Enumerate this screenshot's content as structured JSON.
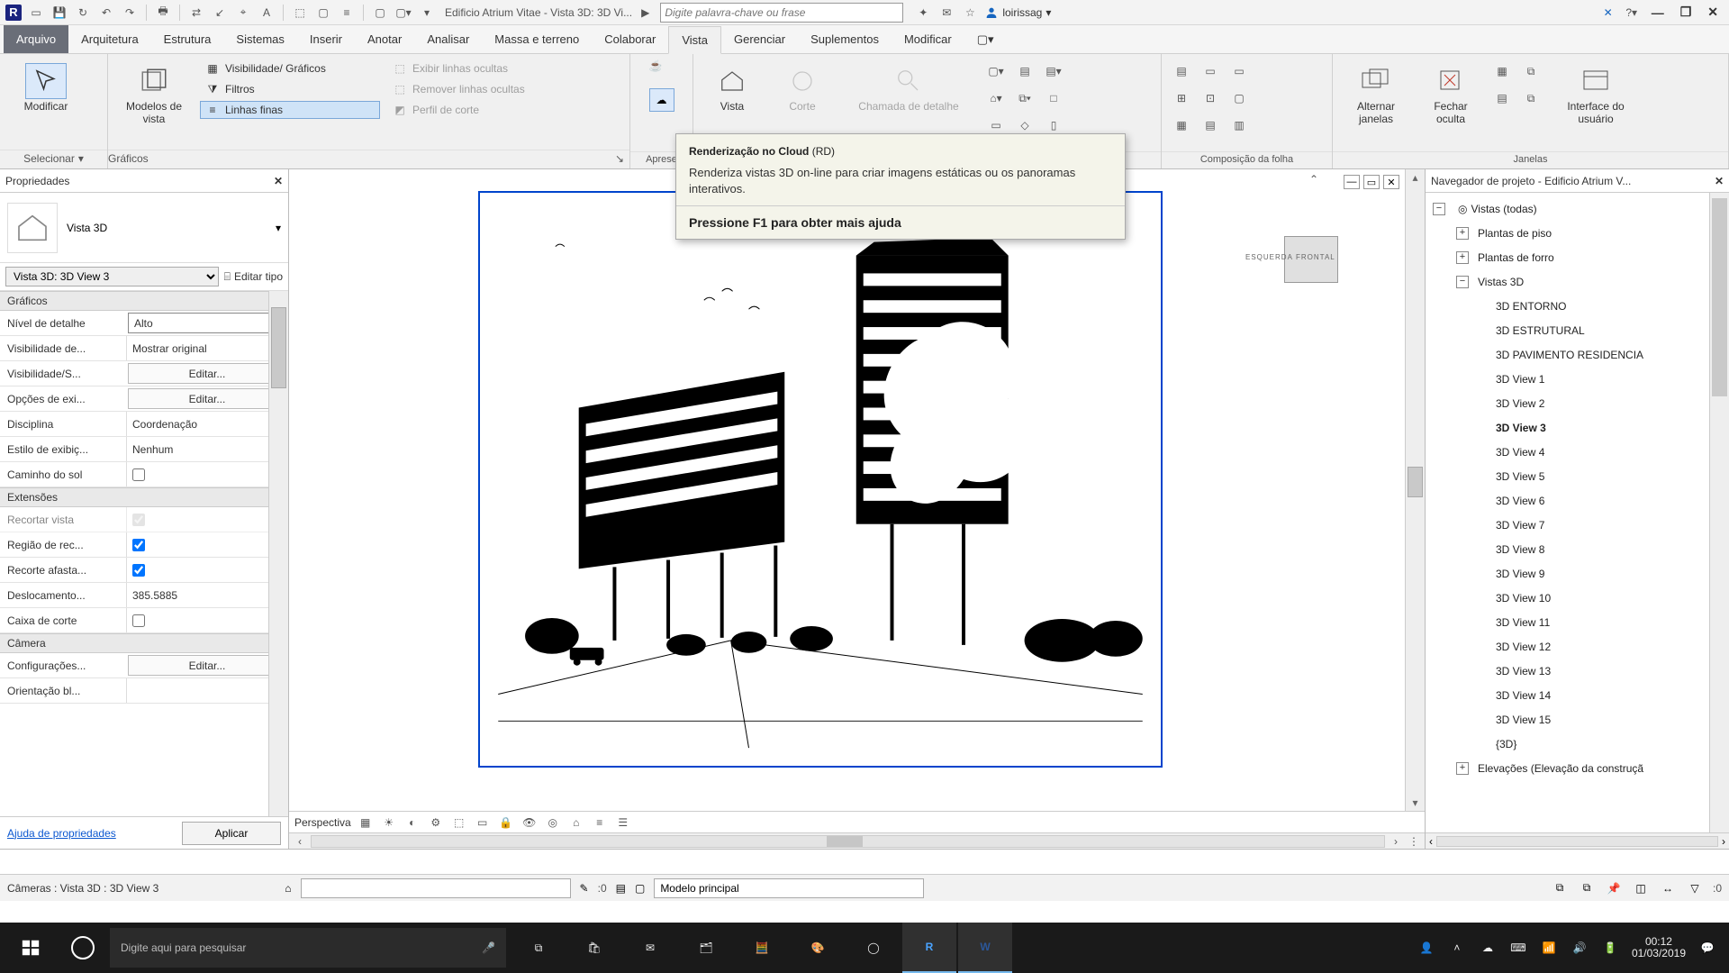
{
  "qat": {
    "title": "Edificio Atrium Vitae - Vista 3D: 3D Vi...",
    "search_placeholder": "Digite palavra-chave ou frase",
    "user": "loirissag"
  },
  "tabs": {
    "file": "Arquivo",
    "items": [
      "Arquitetura",
      "Estrutura",
      "Sistemas",
      "Inserir",
      "Anotar",
      "Analisar",
      "Massa e terreno",
      "Colaborar",
      "Vista",
      "Gerenciar",
      "Suplementos",
      "Modificar"
    ],
    "active": "Vista"
  },
  "ribbon": {
    "selecionar": {
      "btn": "Modificar",
      "panel": "Selecionar"
    },
    "graficos": {
      "modelos": "Modelos de\nvista",
      "vg": "Visibilidade/  Gráficos",
      "filtros": "Filtros",
      "linhas": "Linhas  finas",
      "exibir": "Exibir  linhas ocultas",
      "remover": "Remover  linhas ocultas",
      "perfil": "Perfil  de corte",
      "panel": "Gráficos"
    },
    "apresentacao": {
      "panel": "Aprese"
    },
    "criar": {
      "vista": "Vista",
      "corte": "Corte",
      "chamada": "Chamada de detalhe"
    },
    "composicao": {
      "panel": "Composição da folha"
    },
    "janelas": {
      "alternar": "Alternar\njanelas",
      "fechar": "Fechar\noculta",
      "ui": "Interface do\nusuário",
      "panel": "Janelas"
    }
  },
  "tooltip": {
    "title_b": "Renderização no Cloud",
    "title_s": " (RD)",
    "body": "Renderiza vistas 3D on-line para criar imagens estáticas ou os panoramas interativos.",
    "f1": "Pressione F1 para obter mais ajuda"
  },
  "props": {
    "header": "Propriedades",
    "family": "Vista 3D",
    "selector": "Vista 3D: 3D View 3",
    "edit_type": "Editar tipo",
    "groups": {
      "graficos": "Gráficos",
      "extensoes": "Extensões",
      "camera": "Câmera"
    },
    "rows": {
      "nivel_k": "Nível de detalhe",
      "nivel_v": "Alto",
      "vis_k": "Visibilidade de...",
      "vis_v": "Mostrar original",
      "visS_k": "Visibilidade/S...",
      "edit_btn": "Editar...",
      "opc_k": "Opções de exi...",
      "disc_k": "Disciplina",
      "disc_v": "Coordenação",
      "estilo_k": "Estilo de exibiç...",
      "estilo_v": "Nenhum",
      "sol_k": "Caminho do sol",
      "recortar_k": "Recortar vista",
      "regiao_k": "Região de rec...",
      "recorte_k": "Recorte afasta...",
      "desloc_k": "Deslocamento...",
      "desloc_v": "385.5885",
      "caixa_k": "Caixa de corte",
      "config_k": "Configurações...",
      "orient_k": "Orientação bl..."
    },
    "footer_help": "Ajuda de propriedades",
    "footer_apply": "Aplicar"
  },
  "viewbar": {
    "mode": "Perspectiva"
  },
  "browser": {
    "header": "Navegador de projeto - Edificio Atrium V...",
    "root": "Vistas (todas)",
    "plantas_piso": "Plantas de piso",
    "plantas_forro": "Plantas de forro",
    "vistas3d": "Vistas 3D",
    "views3d": [
      "3D ENTORNO",
      "3D ESTRUTURAL",
      "3D PAVIMENTO RESIDENCIA",
      "3D View 1",
      "3D View 2",
      "3D View 3",
      "3D View 4",
      "3D View 5",
      "3D View 6",
      "3D View 7",
      "3D View 8",
      "3D View 9",
      "3D View 10",
      "3D View 11",
      "3D View 12",
      "3D View 13",
      "3D View 14",
      "3D View 15",
      "{3D}"
    ],
    "current": "3D View 3",
    "elev": "Elevações (Elevação da construçã"
  },
  "viewcube": {
    "left": "ESQUERDA",
    "front": "FRONTAL"
  },
  "status": {
    "path": "Câmeras : Vista 3D : 3D View 3",
    "zero": ":0",
    "model": "Modelo principal"
  },
  "taskbar": {
    "search": "Digite aqui para pesquisar",
    "time": "00:12",
    "date": "01/03/2019"
  }
}
